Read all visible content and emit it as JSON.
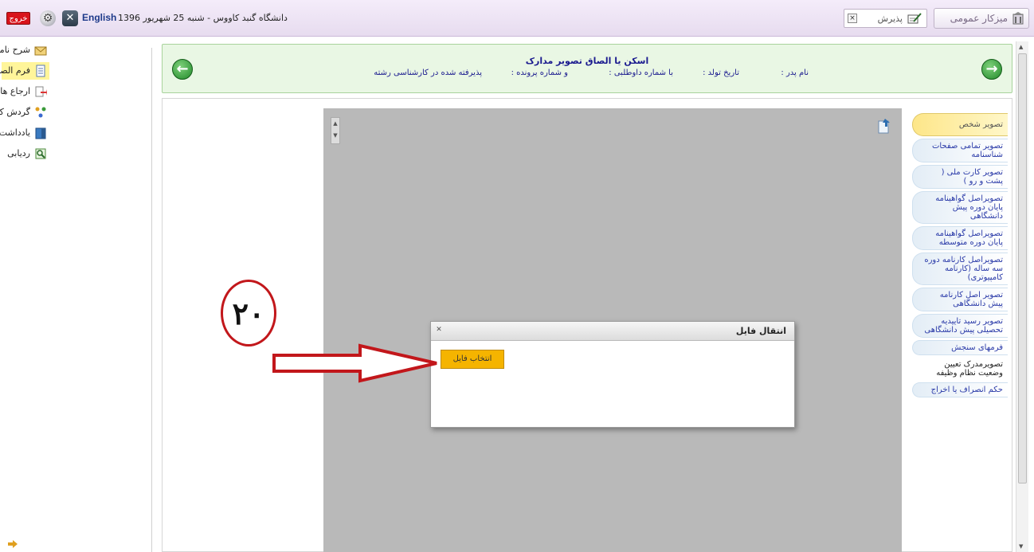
{
  "topbar": {
    "exit_label": "خروج",
    "language_label": "English",
    "date_line": "دانشگاه گنبد کاووس - شنبه 25 شهریور 1396",
    "desk_label": "میزکار عمومی",
    "admission_label": "پذیرش"
  },
  "left_menu": {
    "items": [
      {
        "label": "شرح نامه",
        "active": false
      },
      {
        "label": "فرم الصاقی",
        "active": true
      },
      {
        "label": "ارجاع ها",
        "active": false
      },
      {
        "label": "گردش کار",
        "active": false
      },
      {
        "label": "یادداشت",
        "active": false
      },
      {
        "label": "ردیابی",
        "active": false
      }
    ]
  },
  "header": {
    "title": "اسکن یا الصاق تصویر مدارک",
    "father_name": "نام پدر :",
    "birth_date": "تاریخ تولد :",
    "applicant_no": "با شماره داوطلبی :",
    "file_no": "و شماره پرونده :",
    "accepted": "پذیرفته شده در کارشناسی رشته"
  },
  "doc_tabs": [
    "تصویر شخص",
    "تصویر تمامی صفحات شناسنامه",
    "تصویر کارت ملی ( پشت و رو )",
    "تصویراصل گواهینامه پایان دوره پیش دانشگاهی",
    "تصویراصل گواهینامه پایان دوره متوسطه",
    "تصویراصل کارنامه دوره سه ساله (کارنامه کامپیوتری)",
    "تصویر اصل کارنامه پیش دانشگاهی",
    "تصویر رسید تاییدیه تحصیلی پیش دانشگاهی",
    "فرمهای سنجش",
    "تصویرمدرک تعیین وضعیت نظام وظیفه",
    "حکم انصراف یا اخراج"
  ],
  "modal": {
    "title": "انتقال فایل",
    "choose_file_label": "انتخاب فایل"
  },
  "annotation": {
    "step_number": "۲۰"
  },
  "colors": {
    "exit_red": "#d9141b",
    "header_green": "#e9f7e4",
    "button_yellow": "#f5b400",
    "annotation_red": "#c2171b"
  }
}
